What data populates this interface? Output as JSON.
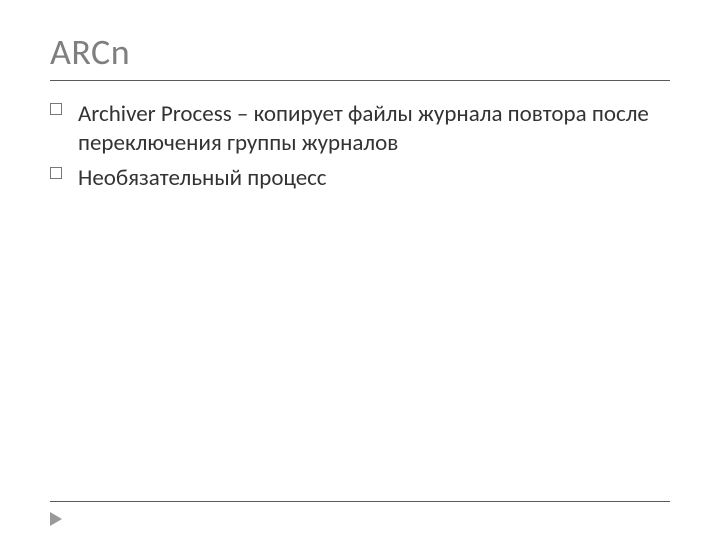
{
  "slide": {
    "title": "ARCn",
    "bullets": [
      "Archiver Process – копирует файлы журнала повтора после переключения группы журналов",
      "Необязательный процесс"
    ]
  }
}
